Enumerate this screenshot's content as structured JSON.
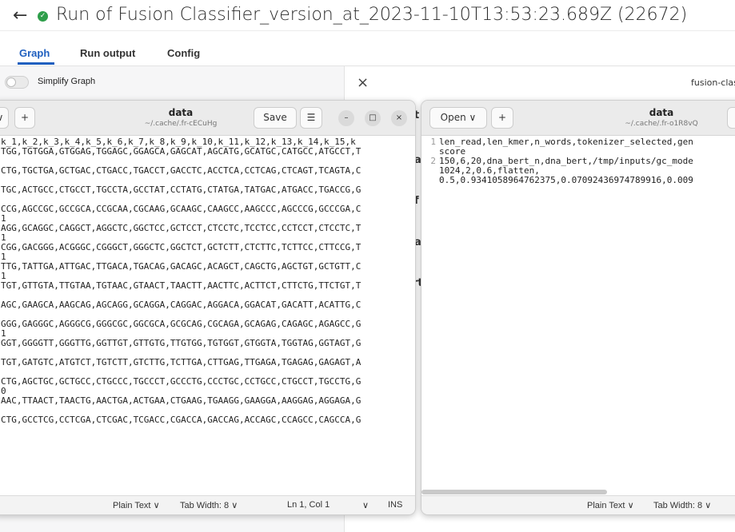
{
  "header": {
    "back_icon": "arrow-left-icon",
    "status_icon": "check-circle-icon",
    "status_color": "#2e9e4a",
    "title": "Run of Fusion Classifier_version_at_2023-11-10T13:53:23.689Z (22672)"
  },
  "tabs": [
    {
      "label": "Graph",
      "active": true
    },
    {
      "label": "Run output",
      "active": false
    },
    {
      "label": "Config",
      "active": false
    }
  ],
  "accent_color": "#1f5fbf",
  "graph_panel": {
    "simplify_label": "Simplify Graph"
  },
  "config_panel": {
    "close_glyph": "×",
    "name": "fusion-clas",
    "peek_letters": [
      "t",
      "a",
      "f",
      "a",
      "rt"
    ]
  },
  "editor_left": {
    "open_glyph": "∨",
    "new_tab_glyph": "+",
    "title": "data",
    "subtitle": "~/.cache/.fr-cECuHg",
    "save_label": "Save",
    "menu_glyph": "☰",
    "minimize_glyph": "–",
    "maximize_glyph": "□",
    "close_glyph": "×",
    "lines": [
      "k_1,k_2,k_3,k_4,k_5,k_6,k_7,k_8,k_9,k_10,k_11,k_12,k_13,k_14,k_15,k",
      "TGG,TGTGGA,GTGGAG,TGGAGC,GGAGCA,GAGCAT,AGCATG,GCATGC,CATGCC,ATGCCT,T",
      "",
      "CTG,TGCTGA,GCTGAC,CTGACC,TGACCT,GACCTC,ACCTCA,CCTCAG,CTCAGT,TCAGTA,C",
      "",
      "TGC,ACTGCC,CTGCCT,TGCCTA,GCCTAT,CCTATG,CTATGA,TATGAC,ATGACC,TGACCG,G",
      "",
      "CCG,AGCCGC,GCCGCA,CCGCAA,CGCAAG,GCAAGC,CAAGCC,AAGCCC,AGCCCG,GCCCGA,C",
      "1",
      "AGG,GCAGGC,CAGGCT,AGGCTC,GGCTCC,GCTCCT,CTCCTC,TCCTCC,CCTCCT,CTCCTC,T",
      "1",
      "CGG,GACGGG,ACGGGC,CGGGCT,GGGCTC,GGCTCT,GCTCTT,CTCTTC,TCTTCC,CTTCCG,T",
      "1",
      "TTG,TATTGA,ATTGAC,TTGACA,TGACAG,GACAGC,ACAGCT,CAGCTG,AGCTGT,GCTGTT,C",
      "1",
      "TGT,GTTGTA,TTGTAA,TGTAAC,GTAACT,TAACTT,AACTTC,ACTTCT,CTTCTG,TTCTGT,T",
      "",
      "AGC,GAAGCA,AAGCAG,AGCAGG,GCAGGA,CAGGAC,AGGACA,GGACAT,GACATT,ACATTG,C",
      "",
      "GGG,GAGGGC,AGGGCG,GGGCGC,GGCGCA,GCGCAG,CGCAGA,GCAGAG,CAGAGC,AGAGCC,G",
      "1",
      "GGT,GGGGTT,GGGTTG,GGTTGT,GTTGTG,TTGTGG,TGTGGT,GTGGTA,TGGTAG,GGTAGT,G",
      "",
      "TGT,GATGTC,ATGTCT,TGTCTT,GTCTTG,TCTTGA,CTTGAG,TTGAGA,TGAGAG,GAGAGT,A",
      "",
      "CTG,AGCTGC,GCTGCC,CTGCCC,TGCCCT,GCCCTG,CCCTGC,CCTGCC,CTGCCT,TGCCTG,G",
      "0",
      "AAC,TTAACT,TAACTG,AACTGA,ACTGAA,CTGAAG,TGAAGG,GAAGGA,AAGGAG,AGGAGA,G",
      "",
      "CTG,GCCTCG,CCTCGA,CTCGAC,TCGACC,CGACCA,GACCAG,ACCAGC,CCAGCC,CAGCCA,G"
    ],
    "status": {
      "language": "Plain Text",
      "tab_width": "Tab Width: 8",
      "position": "Ln 1, Col 1",
      "mode": "INS",
      "chevron": "∨"
    }
  },
  "editor_right": {
    "open_label": "Open",
    "open_glyph": "∨",
    "new_tab_glyph": "+",
    "title": "data",
    "subtitle": "~/.cache/.fr-o1R8vQ",
    "lines": [
      {
        "n": "1",
        "text": "len_read,len_kmer,n_words,tokenizer_selected,gen"
      },
      {
        "n": "",
        "text": "score"
      },
      {
        "n": "2",
        "text": "150,6,20,dna_bert_n,dna_bert,/tmp/inputs/gc_mode"
      },
      {
        "n": "",
        "text": "1024,2,0.6,flatten,"
      },
      {
        "n": "",
        "text": "0.5,0.9341058964762375,0.07092436974789916,0.009"
      }
    ],
    "status": {
      "language": "Plain Text",
      "tab_width": "Tab Width: 8",
      "chevron": "∨"
    }
  }
}
